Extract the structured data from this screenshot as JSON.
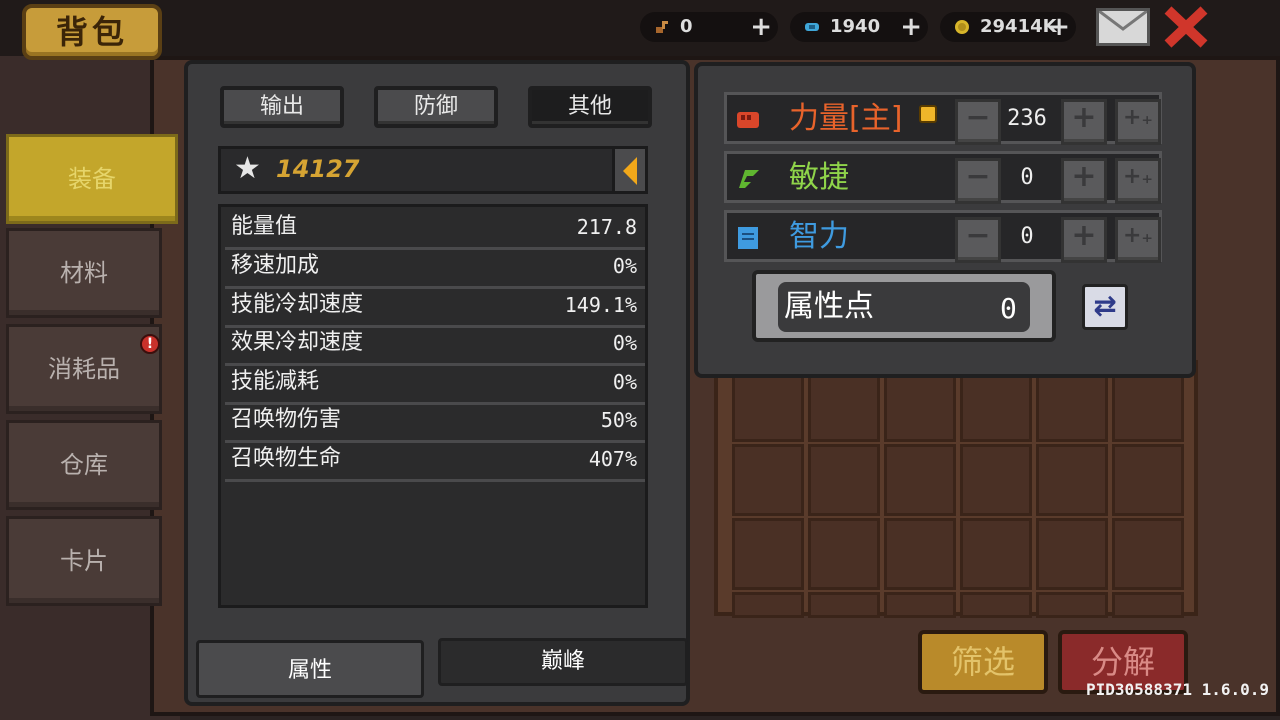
{
  "header": {
    "title": "背包",
    "currencies": [
      {
        "icon": "key-icon",
        "value": "0"
      },
      {
        "icon": "gem-icon",
        "value": "1940"
      },
      {
        "icon": "gold-coin-icon",
        "value": "29414K"
      }
    ],
    "plus": "+"
  },
  "sidebar": {
    "items": [
      {
        "label": "装备"
      },
      {
        "label": "材料"
      },
      {
        "label": "消耗品",
        "badge": "!"
      },
      {
        "label": "仓库"
      },
      {
        "label": "卡片"
      }
    ]
  },
  "stats": {
    "tabs": [
      "输出",
      "防御",
      "其他"
    ],
    "score": "14127",
    "rows": [
      {
        "name": "能量值",
        "value": "217.8"
      },
      {
        "name": "移速加成",
        "value": "0%"
      },
      {
        "name": "技能冷却速度",
        "value": "149.1%"
      },
      {
        "name": "效果冷却速度",
        "value": "0%"
      },
      {
        "name": "技能减耗",
        "value": "0%"
      },
      {
        "name": "召唤物伤害",
        "value": "50%"
      },
      {
        "name": "召唤物生命",
        "value": "407%"
      }
    ],
    "bottom_tabs": [
      "属性",
      "巅峰"
    ]
  },
  "attributes": {
    "rows": [
      {
        "label": "力量[主]",
        "value": "236",
        "color": "#e8632b",
        "icon": "fist-icon"
      },
      {
        "label": "敏捷",
        "value": "0",
        "color": "#8fd44a",
        "icon": "feather-icon"
      },
      {
        "label": "智力",
        "value": "0",
        "color": "#3f9be0",
        "icon": "book-icon"
      }
    ],
    "points_label": "属性点",
    "points_value": "0",
    "minus": "−",
    "plus": "+",
    "plus_plus": "+₊"
  },
  "actions": {
    "filter": "筛选",
    "dismantle": "分解"
  },
  "version": "PID30588371 1.6.0.9"
}
